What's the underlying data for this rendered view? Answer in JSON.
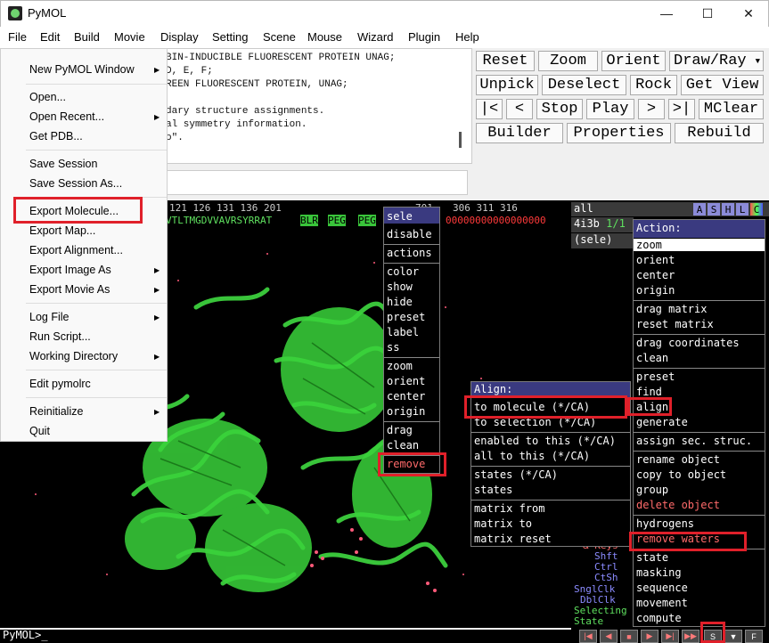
{
  "window": {
    "title": "PyMOL",
    "minimize": "—",
    "maximize": "☐",
    "close": "✕"
  },
  "menubar": [
    "File",
    "Edit",
    "Build",
    "Movie",
    "Display",
    "Setting",
    "Scene",
    "Mouse",
    "Wizard",
    "Plugin",
    "Help"
  ],
  "console_lines": [
    "BIN-INDUCIBLE FLUORESCENT PROTEIN UNAG;",
    "D, E, F;",
    "REEN FLUORESCENT PROTEIN, UNAG;",
    "",
    "dary structure assignments.",
    "al symmetry information.",
    "o\"."
  ],
  "buttons": [
    [
      "Reset",
      "Zoom",
      "Orient",
      "Draw/Ray"
    ],
    [
      "Unpick",
      "Deselect",
      "Rock",
      "Get View"
    ],
    [
      "|<",
      "<",
      "Stop",
      "Play",
      ">",
      ">|",
      "MClear"
    ],
    [
      "Builder",
      "Properties",
      "Rebuild"
    ]
  ],
  "sequence": {
    "numbers": "121  126  131  136 201",
    "numbers_right": "306  311  316",
    "ticks_mid": "701",
    "residues": "VTLTMGDVVAVRSYRRAT",
    "tags": [
      "BLR",
      "PEG",
      "PEG"
    ],
    "zeros": "00000000000000000"
  },
  "file_menu": [
    {
      "label": "New PyMOL Window",
      "arrow": true
    },
    {
      "label": "Open..."
    },
    {
      "label": "Open Recent...",
      "arrow": true
    },
    {
      "label": "Get PDB..."
    },
    {
      "label": "Save Session"
    },
    {
      "label": "Save Session As..."
    },
    {
      "label": "Export Molecule..."
    },
    {
      "label": "Export Map..."
    },
    {
      "label": "Export Alignment..."
    },
    {
      "label": "Export Image As",
      "arrow": true
    },
    {
      "label": "Export Movie As",
      "arrow": true
    },
    {
      "label": "Log File",
      "arrow": true
    },
    {
      "label": "Run Script..."
    },
    {
      "label": "Working Directory",
      "arrow": true
    },
    {
      "label": "Edit pymolrc"
    },
    {
      "label": "Reinitialize",
      "arrow": true
    },
    {
      "label": "Quit"
    }
  ],
  "objects": {
    "all": "all",
    "obj": "4i3b",
    "obj_count": "1/1",
    "sele": "(sele)",
    "ashlc": [
      "A",
      "S",
      "H",
      "L",
      "C"
    ]
  },
  "sele_menu": [
    "sele",
    "disable",
    "actions",
    "color",
    "show",
    "hide",
    "preset",
    "label",
    "ss",
    "zoom",
    "orient",
    "center",
    "origin",
    "drag",
    "clean",
    "remove"
  ],
  "align_menu": {
    "header": "Align:",
    "items": [
      "to molecule (*/CA)",
      "to selection (*/CA)",
      "enabled to this (*/CA)",
      "all to this (*/CA)",
      "states (*/CA)",
      "states",
      "matrix from",
      "matrix to",
      "matrix reset"
    ]
  },
  "action_menu": {
    "header": "Action:",
    "items": [
      "zoom",
      "orient",
      "center",
      "origin",
      "drag matrix",
      "reset matrix",
      "drag coordinates",
      "clean",
      "preset",
      "find",
      "align",
      "generate",
      "assign sec. struc.",
      "rename object",
      "copy to object",
      "group",
      "delete object",
      "hydrogens",
      "remove waters",
      "state",
      "masking",
      "sequence",
      "movement",
      "compute"
    ]
  },
  "mouse_legend": [
    "& Keys",
    "Shft",
    "Ctrl",
    "CtSh",
    "SnglClk",
    "DblClk",
    "Selecting",
    "State"
  ],
  "prompt": "PyMOL>_",
  "player": [
    "|◀",
    "◀",
    "■",
    "▶",
    "▶|",
    "▶▶",
    "S",
    "▼",
    "F"
  ]
}
